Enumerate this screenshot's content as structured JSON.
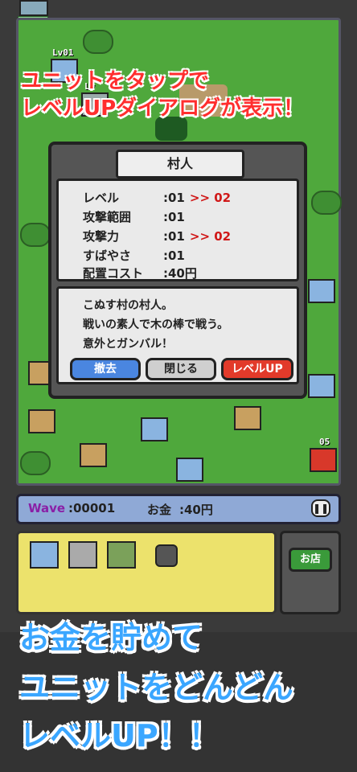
{
  "caption_top": [
    "ユニットをタップで",
    "レベルUPダイアログが表示！"
  ],
  "field": {
    "unit_levels": [
      "Lv01",
      "Lv",
      "05"
    ]
  },
  "dialog": {
    "title": "村人",
    "stats": [
      {
        "label": "レベル",
        "value": ":01",
        "next": ">> 02"
      },
      {
        "label": "攻撃範囲",
        "value": ":01",
        "next": ""
      },
      {
        "label": "攻撃力",
        "value": ":01",
        "next": ">> 02"
      },
      {
        "label": "すばやさ",
        "value": ":01",
        "next": ""
      },
      {
        "label": "配置コスト",
        "value": ":40円",
        "next": ""
      }
    ],
    "description": [
      "こぬす村の村人。",
      "戦いの素人で木の棒で戦う。",
      "意外とガンバル！"
    ],
    "buttons": {
      "remove": "撤去",
      "close": "閉じる",
      "levelup": "レベルUP"
    }
  },
  "status": {
    "wave_label": "Wave",
    "wave_value": ":00001",
    "money_label": "お金",
    "money_value": ":40円"
  },
  "shop": {
    "label": "お店"
  },
  "caption_bottom": [
    "お金を貯めて",
    "ユニットをどんどん",
    "レベルUP！！"
  ],
  "colors": {
    "field": "#4fa83c",
    "caption_red": "#ff2e2e",
    "caption_blue": "#3aa6ff",
    "levelup_button": "#e23a2a",
    "remove_button": "#4a86e0",
    "close_button": "#cfcfcf",
    "shop_button": "#3a9a3a"
  }
}
